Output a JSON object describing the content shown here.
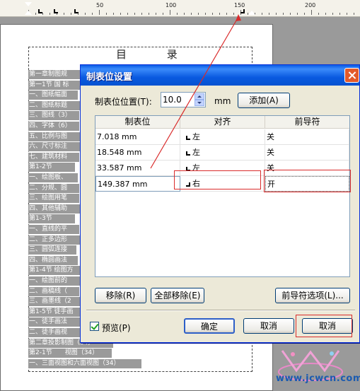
{
  "ruler": {
    "labels": [
      "50",
      "100",
      "150",
      "200"
    ]
  },
  "document": {
    "title": "目 录",
    "lines": [
      "第一章制图规",
      "第一1节 国 标",
      "一、图纸幅面",
      "二、图纸标题",
      "三、图线（3）",
      "四、字体（6）",
      "五、比例与图",
      "六、尺寸标注",
      "七、建筑材料",
      "第1-2节",
      "一、绘图板、",
      "二、分规、圆",
      "三、绘图用笔",
      "四、其他辅助",
      "第1-3节",
      "一、直线的平",
      "二、正多边形",
      "三、圆弧连接",
      "四、椭圆画法",
      "第1-4节 绘图方",
      "一、绘图前的",
      "二、画稿线（",
      "三、画墨线（2",
      "第1-5节 徒手画",
      "一、徒手画法",
      "二、徒手画视",
      "第二章投影制图（34）",
      "第2-1节　　视图（34）",
      "一、三面视图和六面视图（34）"
    ]
  },
  "dialog": {
    "title": "制表位设置",
    "position_label": "制表位位置(T):",
    "position_value": "10.0",
    "unit": "mm",
    "add_button": "添加(A)",
    "columns": [
      "制表位",
      "对齐",
      "前导符"
    ],
    "rows": [
      {
        "pos": "7.018 mm",
        "align": "左",
        "align_type": "left",
        "leader": "关"
      },
      {
        "pos": "18.548 mm",
        "align": "左",
        "align_type": "left",
        "leader": "关"
      },
      {
        "pos": "33.587 mm",
        "align": "左",
        "align_type": "left",
        "leader": "关"
      },
      {
        "pos": "149.387 mm",
        "align": "右",
        "align_type": "right",
        "leader": "开"
      }
    ],
    "remove_button": "移除(R)",
    "remove_all_button": "全部移除(E)",
    "leader_options_button": "前导符选项(L)...",
    "preview_label": "预览(P)",
    "preview_checked": true,
    "ok_button": "确定",
    "cancel_button_1": "取消",
    "cancel_button_2": "取消"
  },
  "watermark": {
    "text": "www.jcwcn.com"
  },
  "colors": {
    "titlebar": "#0a5ce6",
    "highlight": "#d92b2b",
    "toc_highlight": "#9a9a9a"
  }
}
